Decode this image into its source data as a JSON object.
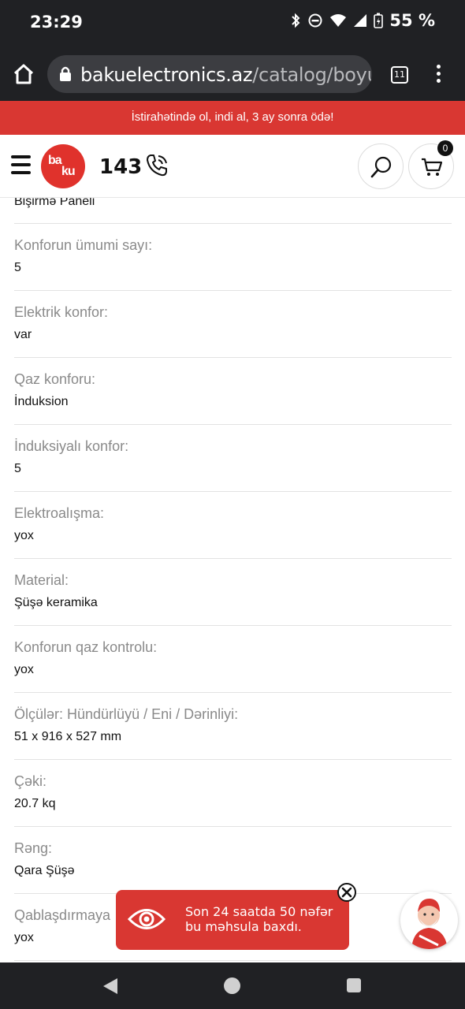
{
  "status_bar": {
    "time": "23:29",
    "battery": "55 %",
    "icons": [
      "bluetooth-icon",
      "dnd-icon",
      "wifi-icon",
      "signal-icon",
      "battery-icon"
    ]
  },
  "browser": {
    "url_main": "bakuelectronics.az",
    "url_path": "/catalog/boyu",
    "tab_count": "11"
  },
  "promo": {
    "text": "İstirahətində ol, indi al, 3 ay sonra ödə!"
  },
  "header": {
    "logo_top": "ba",
    "logo_bottom": "ku",
    "hotline": "143",
    "cart_count": "0"
  },
  "specs": {
    "first_value": "Bişirmə Paneli",
    "items": [
      {
        "label": "Konforun ümumi sayı:",
        "value": "5"
      },
      {
        "label": "Elektrik konfor:",
        "value": "var"
      },
      {
        "label": "Qaz konforu:",
        "value": "İnduksion"
      },
      {
        "label": "İnduksiyalı konfor:",
        "value": "5"
      },
      {
        "label": "Elektroalışma:",
        "value": "yox"
      },
      {
        "label": "Material:",
        "value": "Şüşə keramika"
      },
      {
        "label": "Konforun qaz kontrolu:",
        "value": "yox"
      },
      {
        "label": "Ölçülər: Hündürlüyü / Eni / Dərinliyi:",
        "value": "51 x 916 x 527 mm"
      },
      {
        "label": "Çəki:",
        "value": "20.7 kq"
      },
      {
        "label": "Rəng:",
        "value": "Qara Şüşə"
      },
      {
        "label": "Qablaşdırmaya",
        "value": "yox"
      }
    ]
  },
  "toast": {
    "line1": "Son 24 saatda 50 nəfər",
    "line2": "bu məhsula baxdı."
  },
  "colors": {
    "brand_red": "#d93732",
    "chrome_dark": "#202124",
    "label_gray": "#8a8a8a"
  }
}
